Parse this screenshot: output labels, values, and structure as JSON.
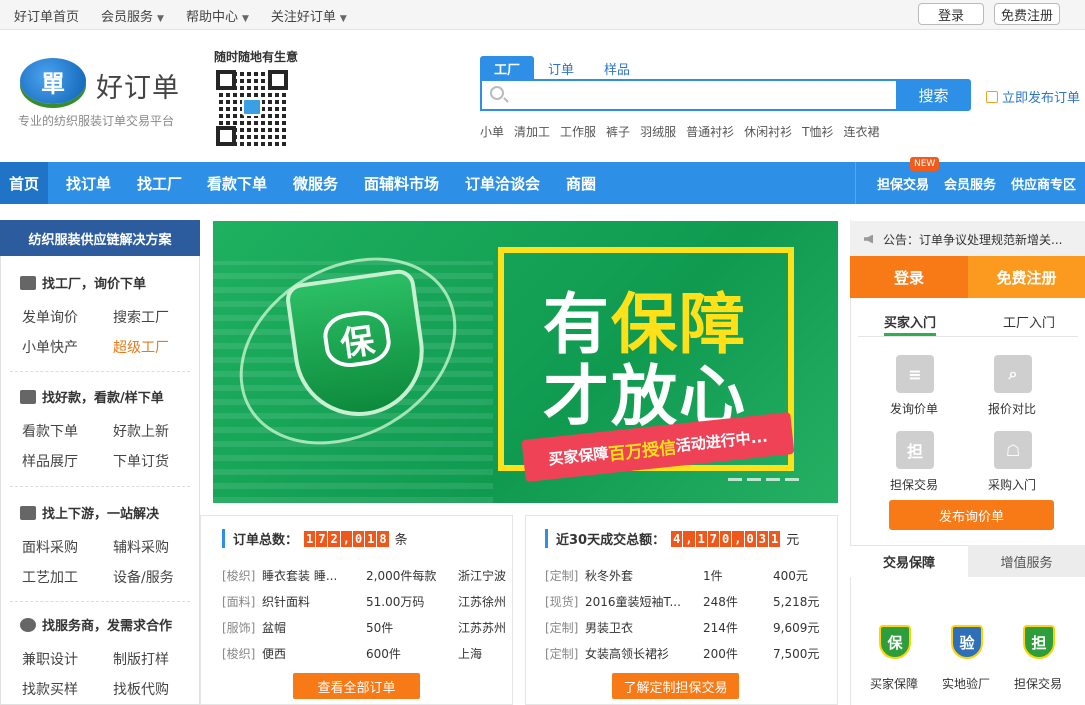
{
  "topbar": {
    "links": [
      {
        "label": "好订单首页",
        "caret": false
      },
      {
        "label": "会员服务",
        "caret": true
      },
      {
        "label": "帮助中心",
        "caret": true
      },
      {
        "label": "关注好订单",
        "caret": true
      }
    ],
    "login": "登录",
    "register": "免费注册"
  },
  "header": {
    "logo_char": "單",
    "logo_name": "好订单",
    "slogan": "专业的纺织服装订单交易平台",
    "qr_title": "随时随地有生意"
  },
  "search": {
    "tabs": [
      "工厂",
      "订单",
      "样品"
    ],
    "button": "搜索",
    "placeholder": "",
    "publish": "立即发布订单",
    "hotwords": [
      "小单",
      "清加工",
      "工作服",
      "裤子",
      "羽绒服",
      "普通衬衫",
      "休闲衬衫",
      "T恤衫",
      "连衣裙"
    ]
  },
  "nav": {
    "items": [
      "首页",
      "找订单",
      "找工厂",
      "看款下单",
      "微服务",
      "面辅料市场",
      "订单洽谈会",
      "商圈"
    ],
    "right": [
      "担保交易",
      "会员服务",
      "供应商专区"
    ],
    "new_badge": "NEW"
  },
  "left": {
    "header": "纺织服装供应链解决方案",
    "sections": [
      {
        "title": "找工厂，询价下单",
        "links": [
          "发单询价",
          "搜索工厂",
          "小单快产",
          "超级工厂"
        ]
      },
      {
        "title": "找好款，看款/样下单",
        "links": [
          "看款下单",
          "好款上新",
          "样品展厅",
          "下单订货"
        ]
      },
      {
        "title": "找上下游，一站解决",
        "links": [
          "面料采购",
          "辅料采购",
          "工艺加工",
          "设备/服务"
        ]
      },
      {
        "title": "找服务商，发需求合作",
        "links": [
          "兼职设计",
          "制版打样",
          "找款买样",
          "找板代购"
        ]
      }
    ]
  },
  "banner": {
    "shield_char": "保",
    "line1a": "有",
    "line1b": "保障",
    "line2": "才放心",
    "ribbon_a": "买家保障",
    "ribbon_b": "百万授信",
    "ribbon_c": "活动进行中..."
  },
  "orders": {
    "title": "订单总数：",
    "digits": [
      "1",
      "7",
      "2",
      ",",
      "0",
      "1",
      "8"
    ],
    "unit": "条",
    "rows": [
      {
        "tag": "[梭织]",
        "name": "睡衣套装 睡...",
        "qty": "2,000件每款",
        "loc": "浙江宁波"
      },
      {
        "tag": "[面料]",
        "name": "织针面料",
        "qty": "51.00万码",
        "loc": "江苏徐州"
      },
      {
        "tag": "[服饰]",
        "name": "盆帽",
        "qty": "50件",
        "loc": "江苏苏州"
      },
      {
        "tag": "[梭织]",
        "name": "便西",
        "qty": "600件",
        "loc": "上海"
      }
    ],
    "button": "查看全部订单"
  },
  "deals": {
    "title": "近30天成交总额：",
    "digits": [
      "4",
      ",",
      "1",
      "7",
      "0",
      ",",
      "0",
      "3",
      "1"
    ],
    "unit": "元",
    "rows": [
      {
        "tag": "[定制]",
        "name": "秋冬外套",
        "qty": "1件",
        "amt": "400元"
      },
      {
        "tag": "[现货]",
        "name": "2016童装短袖T...",
        "qty": "248件",
        "amt": "5,218元"
      },
      {
        "tag": "[定制]",
        "name": "男装卫衣",
        "qty": "214件",
        "amt": "9,609元"
      },
      {
        "tag": "[定制]",
        "name": "女装高领长裙衫",
        "qty": "200件",
        "amt": "7,500元"
      }
    ],
    "button": "了解定制担保交易"
  },
  "right": {
    "notice": "公告：订单争议处理规范新增关...",
    "login": "登录",
    "register": "免费注册",
    "tabs": [
      "买家入门",
      "工厂入门"
    ],
    "icons": [
      {
        "label": "发询价单",
        "glyph": "≡"
      },
      {
        "label": "报价对比",
        "glyph": "⌕"
      },
      {
        "label": "担保交易",
        "glyph": "担"
      },
      {
        "label": "采购入门",
        "glyph": "☖"
      }
    ],
    "publish_btn": "发布询价单",
    "gtabs": [
      "交易保障",
      "增值服务"
    ],
    "badges": [
      {
        "label": "买家保障",
        "glyph": "保",
        "color": "#2e9e3c"
      },
      {
        "label": "实地验厂",
        "glyph": "验",
        "color": "#2d6fb8"
      },
      {
        "label": "担保交易",
        "glyph": "担",
        "color": "#2e9e3c"
      }
    ]
  }
}
